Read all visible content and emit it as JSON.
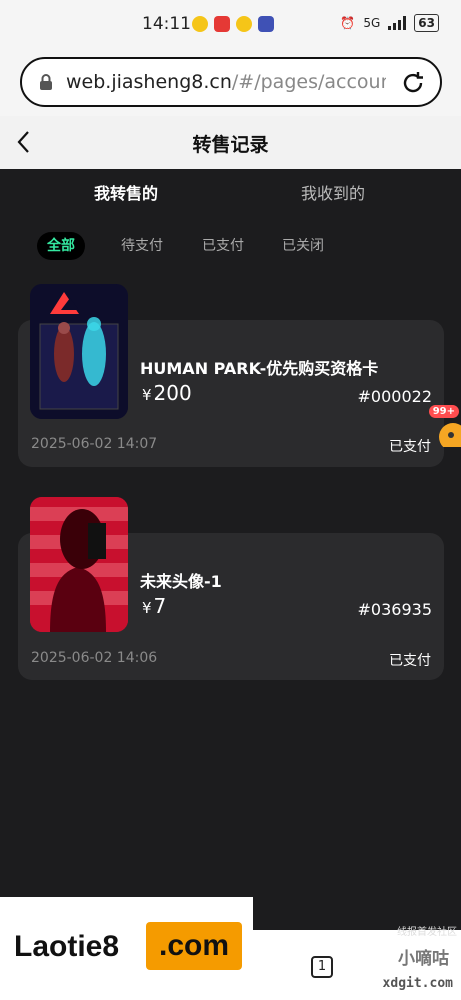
{
  "status_bar": {
    "time": "14:11",
    "network": "5G",
    "battery": "63"
  },
  "browser": {
    "url_host": "web.jiasheng8.cn",
    "url_path": "/#/pages/account/g"
  },
  "header": {
    "title": "转售记录"
  },
  "tabs": [
    {
      "label": "我转售的",
      "active": true
    },
    {
      "label": "我收到的",
      "active": false
    }
  ],
  "filters": [
    {
      "label": "全部",
      "active": true
    },
    {
      "label": "待支付",
      "active": false
    },
    {
      "label": "已支付",
      "active": false
    },
    {
      "label": "已关闭",
      "active": false
    }
  ],
  "records": [
    {
      "title": "HUMAN PARK-优先购买资格卡",
      "currency": "¥",
      "price": "200",
      "code": "#000022",
      "date": "2025-06-02 14:07",
      "status": "已支付"
    },
    {
      "title": "未来头像-1",
      "currency": "¥",
      "price": "7",
      "code": "#036935",
      "date": "2025-06-02 14:06",
      "status": "已支付"
    }
  ],
  "floating_badge": "99+",
  "bottom": {
    "tab_count": "1",
    "watermark_main": "Laotie8",
    "watermark_com": ".com",
    "corner_text": "线报首发社区",
    "site_cn": "小嘀咕",
    "site_url": "xdgit.com"
  },
  "colors": {
    "accent": "#34e8a0",
    "background": "#1c1c1e",
    "card": "#2b2b2d"
  }
}
